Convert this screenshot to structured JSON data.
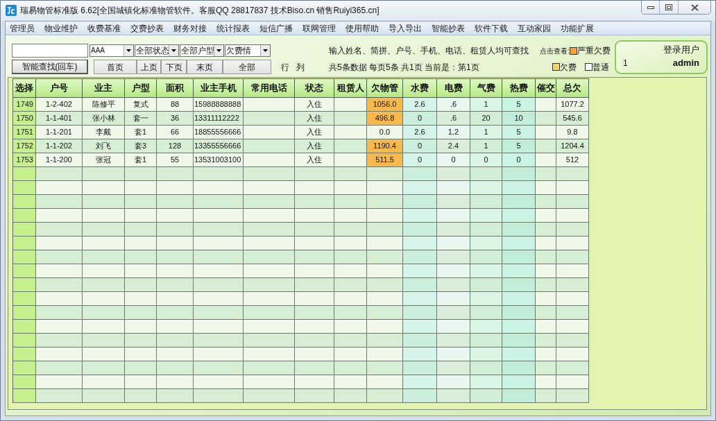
{
  "window": {
    "title": "瑞易物管标准版 6.62[全国城镇化标准物管软件。客服QQ 28817837 技术Biso.cn 销售Ruiyi365.cn]"
  },
  "menu": [
    "管理员",
    "物业维护",
    "收费基准",
    "交费抄表",
    "财务对接",
    "统计报表",
    "短信广播",
    "联网管理",
    "使用帮助",
    "导入导出",
    "智能抄表",
    "软件下载",
    "互动家园",
    "功能扩展"
  ],
  "dropdowns": [
    {
      "value": "AAA"
    },
    {
      "value": "全部状态"
    },
    {
      "value": "全部户型"
    },
    {
      "value": "欠费情"
    }
  ],
  "search_button": "智能查找(回车)",
  "pager_buttons": [
    "首页",
    "上页",
    "下页",
    "末页",
    "全部"
  ],
  "view_labels": [
    "行",
    "列"
  ],
  "hint": "输入姓名、简拼、户号、手机、电话、租赁人均可查找",
  "page_info": "共5条数据 每页5条 共1页 当前是：第1页",
  "legend": {
    "label": "点击查看:",
    "items": [
      {
        "label": "严重欠费",
        "color": "#f7a331"
      },
      {
        "label": "欠费",
        "color": "#fbd36b"
      },
      {
        "label": "普通",
        "color": "#ffffff"
      }
    ]
  },
  "login": {
    "title": "登录用户",
    "id": "1",
    "user": "admin"
  },
  "table": {
    "columns": [
      "选择",
      "户号",
      "业主",
      "户型",
      "面积",
      "业主手机",
      "常用电话",
      "状态",
      "租赁人",
      "欠物管",
      "水费",
      "电费",
      "气费",
      "热费",
      "催交",
      "总欠"
    ],
    "rows": [
      {
        "select": "1749",
        "unit": "1-2-402",
        "owner": "陈修平",
        "type": "复式",
        "area": "88",
        "mobile": "15988888888",
        "status": "入住",
        "property_fee": "1056.0",
        "water": "2.6",
        "electricity": ".6",
        "gas": "1",
        "heating": "5",
        "total": "1077.2",
        "severe_arrears": true
      },
      {
        "select": "1750",
        "unit": "1-1-401",
        "owner": "张小林",
        "type": "套一",
        "area": "36",
        "mobile": "13311112222",
        "status": "入住",
        "property_fee": "496.8",
        "water": "0",
        "electricity": ".6",
        "gas": "20",
        "heating": "10",
        "total": "545.6",
        "severe_arrears": true
      },
      {
        "select": "1751",
        "unit": "1-1-201",
        "owner": "李戴",
        "type": "套1",
        "area": "66",
        "mobile": "18855556666",
        "status": "入住",
        "property_fee": "0.0",
        "water": "2.6",
        "electricity": "1.2",
        "gas": "1",
        "heating": "5",
        "total": "9.8",
        "severe_arrears": false
      },
      {
        "select": "1752",
        "unit": "1-1-202",
        "owner": "刘飞",
        "type": "套3",
        "area": "128",
        "mobile": "13355556666",
        "status": "入住",
        "property_fee": "1190.4",
        "water": "0",
        "electricity": "2.4",
        "gas": "1",
        "heating": "5",
        "total": "1204.4",
        "severe_arrears": true
      },
      {
        "select": "1753",
        "unit": "1-1-200",
        "owner": "张冠",
        "type": "套1",
        "area": "55",
        "mobile": "13531003100",
        "status": "入住",
        "property_fee": "511.5",
        "water": "0",
        "electricity": "0",
        "gas": "0",
        "heating": "0",
        "total": "512",
        "severe_arrears": true
      }
    ]
  }
}
